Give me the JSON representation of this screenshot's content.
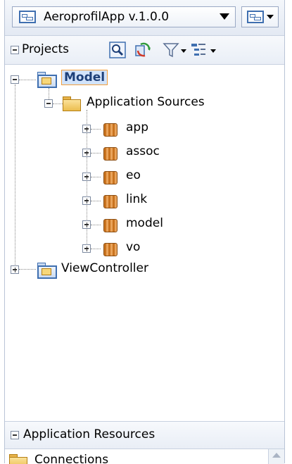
{
  "app_selector": {
    "value": "AeroprofilApp v.1.0.0"
  },
  "projects_panel": {
    "title": "Projects"
  },
  "tree": {
    "model": "Model",
    "application_sources": "Application Sources",
    "packages": [
      "app",
      "assoc",
      "eo",
      "link",
      "model",
      "vo"
    ],
    "view_controller": "ViewController"
  },
  "resources_panel": {
    "title": "Application Resources",
    "first_item_partial": "Connections"
  },
  "colors": {
    "selection_border": "#f29f3d",
    "selection_fill": "#d2e3fb",
    "accent": "#3f6fb0"
  }
}
